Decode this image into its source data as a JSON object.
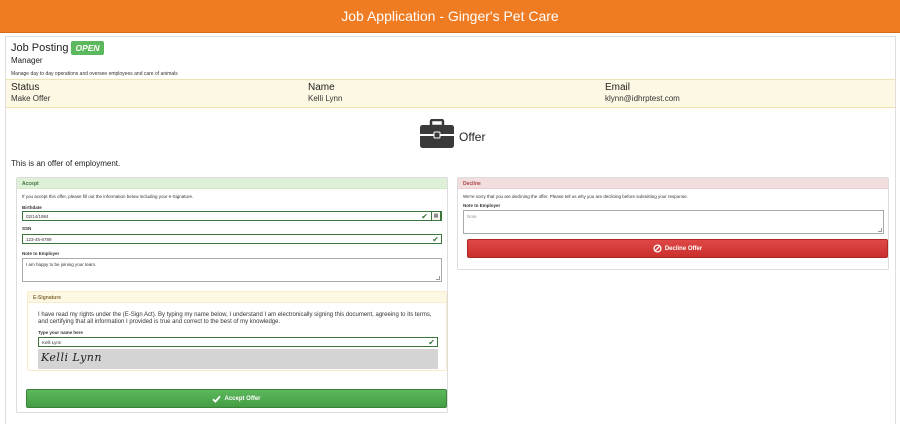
{
  "header": {
    "title": "Job Application - Ginger's Pet Care"
  },
  "posting": {
    "title": "Job Posting",
    "status_badge": "OPEN",
    "role": "Manager",
    "description": "Manage day to day operations and oversee employees and care of animals"
  },
  "info": {
    "status_label": "Status",
    "status_value": "Make Offer",
    "name_label": "Name",
    "name_value": "Kelli Lynn",
    "email_label": "Email",
    "email_value": "klynn@idhrptest.com"
  },
  "offer": {
    "title": "Offer",
    "intro": "This is an offer of employment."
  },
  "accept": {
    "heading": "Accept",
    "instructions": "If you accept this offer, please fill out the information below including your e-Signature.",
    "birthdate_label": "Birthdate",
    "birthdate_value": "02/14/1984",
    "ssn_label": "SSN",
    "ssn_value": "123-45-6789",
    "note_label": "Note to Employer",
    "note_value": "I am happy to be joining your team.",
    "esig_heading": "E-Signature",
    "esig_text": "I have read my rights under the (E-Sign Act). By typing my name below, I understand I am electronically signing this document, agreeing to its terms, and certifying that all information I provided is true and correct to the best of my knowledge.",
    "type_name_label": "Type your name here",
    "typed_name": "Kelli Lynn",
    "signature_render": "Kelli Lynn",
    "button_label": "Accept Offer"
  },
  "decline": {
    "heading": "Decline",
    "instructions": "We're sorry that you are declining the offer. Please tell us why you are declining before submitting your response.",
    "note_label": "Note to Employer",
    "note_placeholder": "Note",
    "button_label": "Decline Offer"
  },
  "colors": {
    "header": "#ef7b22",
    "accept": "#5cb85c",
    "decline": "#d9534f",
    "info_bar": "#fcf8e3"
  },
  "icons": {
    "offer": "briefcase-icon",
    "valid": "check-icon",
    "calendar": "calendar-icon",
    "accept_button": "check-icon",
    "decline_button": "ban-icon"
  }
}
